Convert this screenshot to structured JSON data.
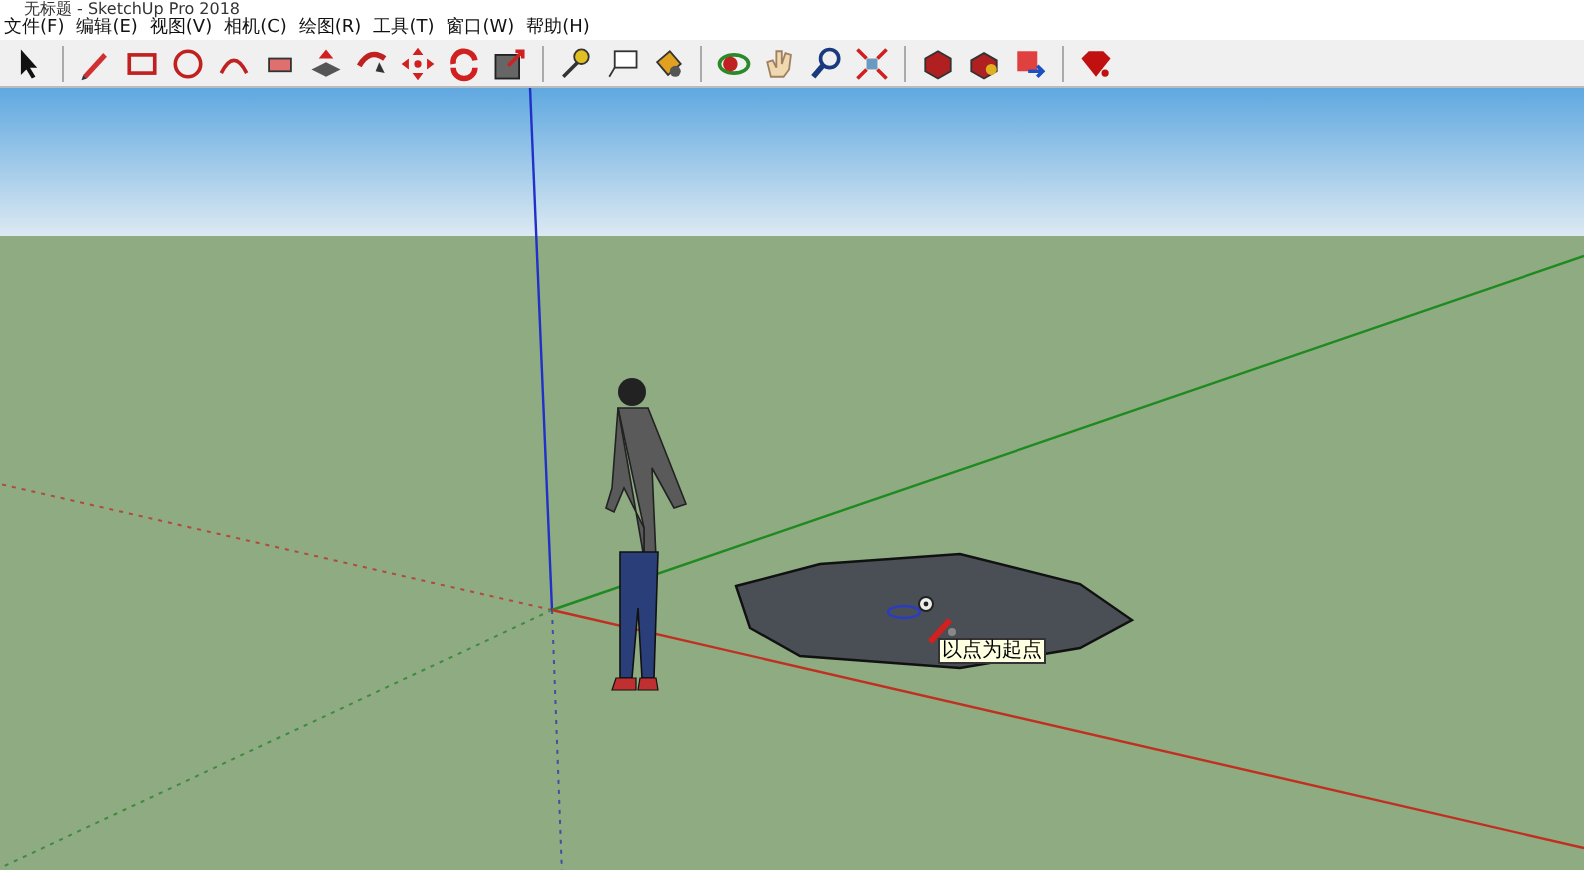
{
  "window": {
    "title": "无标题 - SketchUp Pro 2018"
  },
  "menu": [
    "文件(F)",
    "编辑(E)",
    "视图(V)",
    "相机(C)",
    "绘图(R)",
    "工具(T)",
    "窗口(W)",
    "帮助(H)"
  ],
  "viewport": {
    "tooltip": "以点为起点"
  }
}
